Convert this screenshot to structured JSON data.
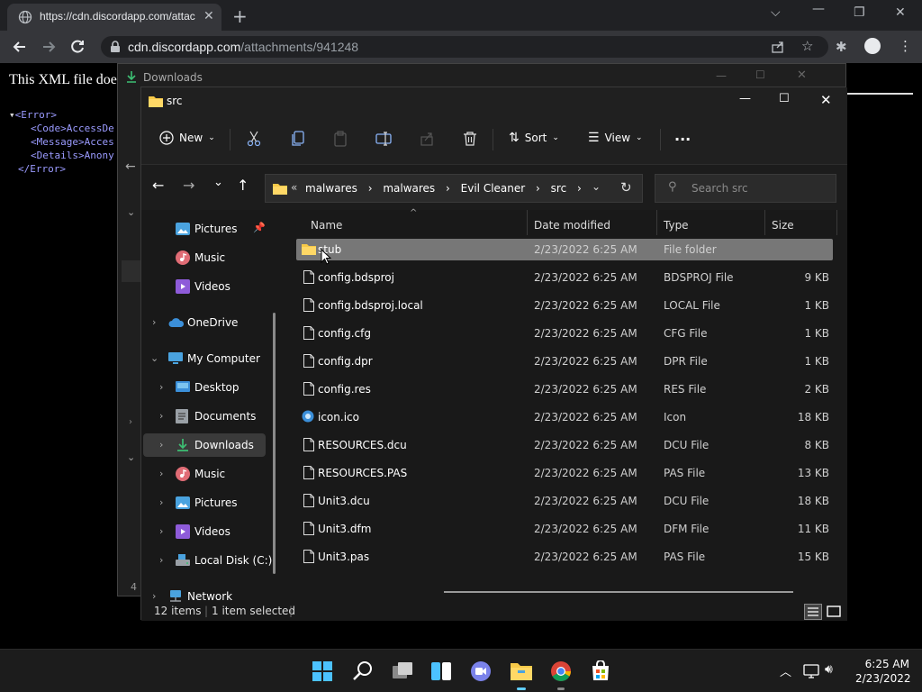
{
  "browser": {
    "tab_title": "https://cdn.discordapp.com/attac",
    "url_host": "cdn.discordapp.com",
    "url_path": "/attachments/941248"
  },
  "xml_page": {
    "heading": "This XML file doe",
    "lines": [
      "<Error>",
      "<Code>AccessDe",
      "<Message>Acces",
      "<Details>Anony",
      "</Error>"
    ]
  },
  "downloads_window": {
    "title": "Downloads",
    "footer_fragment": "4 i"
  },
  "explorer": {
    "title": "src",
    "commands": {
      "new": "New",
      "sort": "Sort",
      "view": "View",
      "more": "..."
    },
    "breadcrumb": [
      "malwares",
      "malwares",
      "Evil Cleaner",
      "src"
    ],
    "breadcrumb_prefix": "«",
    "search_placeholder": "Search src",
    "nav": [
      {
        "label": "Pictures",
        "icon": "pictures-icon",
        "pinned": true
      },
      {
        "label": "Music",
        "icon": "music-icon"
      },
      {
        "label": "Videos",
        "icon": "videos-icon"
      },
      {
        "label": "OneDrive",
        "icon": "onedrive-icon"
      },
      {
        "label": "My Computer",
        "icon": "computer-icon"
      },
      {
        "label": "Desktop",
        "icon": "desktop-icon"
      },
      {
        "label": "Documents",
        "icon": "documents-icon"
      },
      {
        "label": "Downloads",
        "icon": "downloads-icon",
        "selected": true
      },
      {
        "label": "Music",
        "icon": "music-icon"
      },
      {
        "label": "Pictures",
        "icon": "pictures-icon"
      },
      {
        "label": "Videos",
        "icon": "videos-icon"
      },
      {
        "label": "Local Disk (C:)",
        "icon": "disk-icon"
      },
      {
        "label": "Network",
        "icon": "network-icon"
      }
    ],
    "columns": [
      "Name",
      "Date modified",
      "Type",
      "Size"
    ],
    "files": [
      {
        "name": "stub",
        "date": "2/23/2022 6:25 AM",
        "type": "File folder",
        "size": "",
        "folder": true,
        "selected": true
      },
      {
        "name": "config.bdsproj",
        "date": "2/23/2022 6:25 AM",
        "type": "BDSPROJ File",
        "size": "9 KB"
      },
      {
        "name": "config.bdsproj.local",
        "date": "2/23/2022 6:25 AM",
        "type": "LOCAL File",
        "size": "1 KB"
      },
      {
        "name": "config.cfg",
        "date": "2/23/2022 6:25 AM",
        "type": "CFG File",
        "size": "1 KB"
      },
      {
        "name": "config.dpr",
        "date": "2/23/2022 6:25 AM",
        "type": "DPR File",
        "size": "1 KB"
      },
      {
        "name": "config.res",
        "date": "2/23/2022 6:25 AM",
        "type": "RES File",
        "size": "2 KB"
      },
      {
        "name": "icon.ico",
        "date": "2/23/2022 6:25 AM",
        "type": "Icon",
        "size": "18 KB",
        "ico": true
      },
      {
        "name": "RESOURCES.dcu",
        "date": "2/23/2022 6:25 AM",
        "type": "DCU File",
        "size": "8 KB"
      },
      {
        "name": "RESOURCES.PAS",
        "date": "2/23/2022 6:25 AM",
        "type": "PAS File",
        "size": "13 KB"
      },
      {
        "name": "Unit3.dcu",
        "date": "2/23/2022 6:25 AM",
        "type": "DCU File",
        "size": "18 KB"
      },
      {
        "name": "Unit3.dfm",
        "date": "2/23/2022 6:25 AM",
        "type": "DFM File",
        "size": "11 KB"
      },
      {
        "name": "Unit3.pas",
        "date": "2/23/2022 6:25 AM",
        "type": "PAS File",
        "size": "15 KB"
      }
    ],
    "status": {
      "count": "12 items",
      "selection": "1 item selected"
    }
  },
  "taskbar": {
    "time": "6:25 AM",
    "date": "2/23/2022",
    "apps": [
      "start-icon",
      "search-icon",
      "task-view-icon",
      "widgets-icon",
      "teams-chat-icon",
      "file-explorer-icon",
      "chrome-icon",
      "store-icon"
    ]
  }
}
